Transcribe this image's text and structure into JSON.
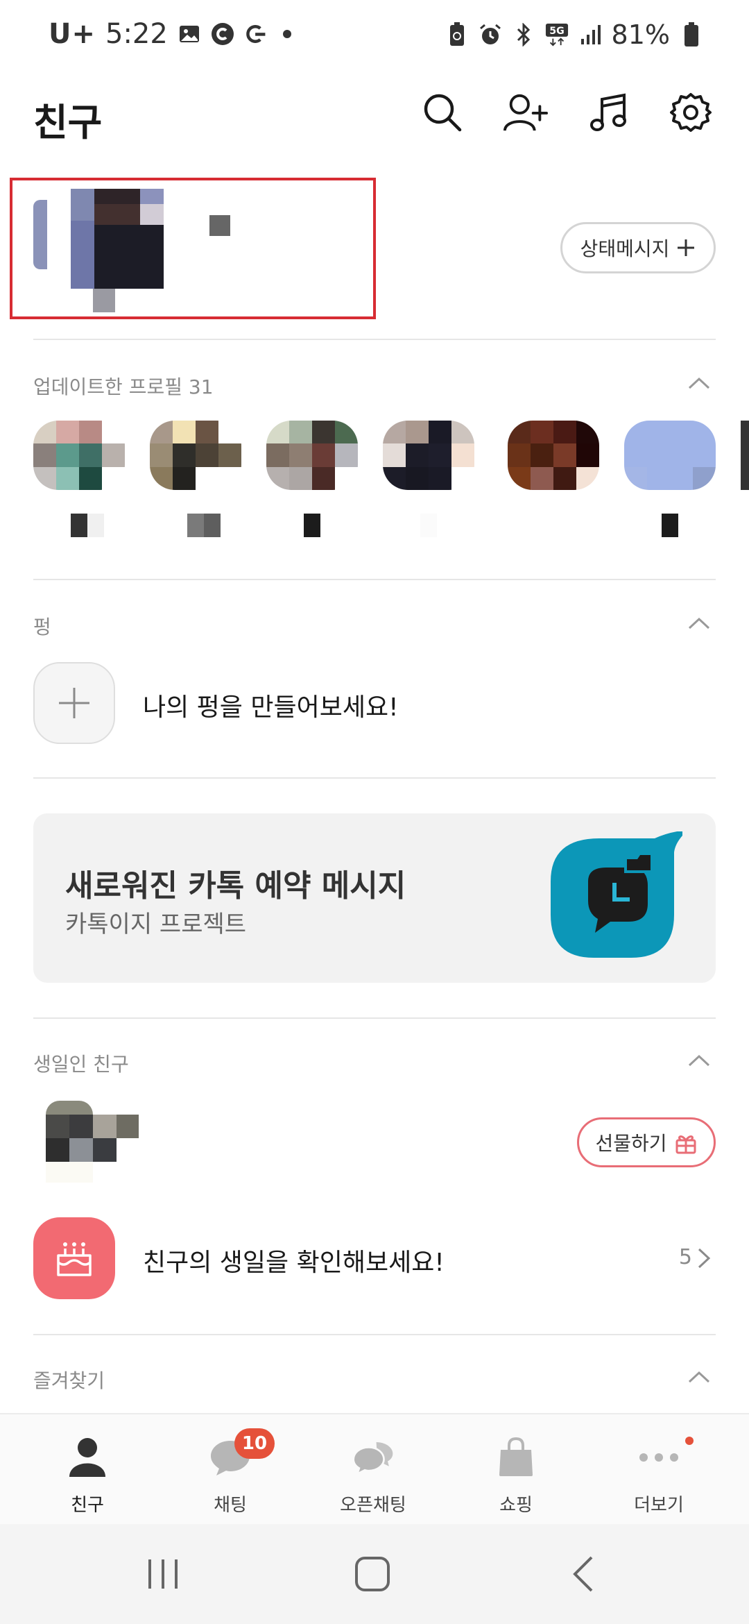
{
  "status_bar": {
    "carrier": "U+",
    "time": "5:22",
    "battery": "81%",
    "icons": [
      "gallery-icon",
      "c-icon",
      "g-icon",
      "recycle-battery-icon",
      "alarm-icon",
      "bluetooth-icon",
      "5g-icon",
      "signal-icon",
      "battery-icon"
    ]
  },
  "header": {
    "title": "친구",
    "icons": [
      "search-icon",
      "add-friend-icon",
      "music-icon",
      "settings-icon"
    ]
  },
  "my_profile": {
    "status_message_label": "상태메시지"
  },
  "updated_profiles": {
    "title": "업데이트한 프로필 31",
    "items": [
      {
        "colors": [
          "#d8cfc2",
          "#d6a9a4",
          "#b88a85",
          "#ffffff",
          "#8a807c",
          "#5c9a8c",
          "#3f6f66",
          "#b9b1ac",
          "#c4c0be",
          "#8cc0b4",
          "#1e4a40",
          "#ffffff"
        ]
      },
      {
        "colors": [
          "#a8988a",
          "#f2e2b4",
          "#6a5444",
          "#ffffff",
          "#9a8c74",
          "#2f2e2a",
          "#4c4236",
          "#6c604c",
          "#8a7a5c",
          "#23221f",
          "#ffffff",
          "#ffffff"
        ]
      },
      {
        "colors": [
          "#d6dac8",
          "#a6b4a2",
          "#3b3530",
          "#4c6a50",
          "#7b6c60",
          "#8e7e72",
          "#6a3c36",
          "#b6b6bc",
          "#b6b0ae",
          "#aca6a4",
          "#4a2a26",
          "#ffffff"
        ]
      },
      {
        "colors": [
          "#b6a8a2",
          "#aa988e",
          "#1a1a26",
          "#cdc4be",
          "#e4dcd8",
          "#1c1c28",
          "#1e1e2c",
          "#f4e0d2",
          "#1c1c28",
          "#181822",
          "#1a1a26",
          "#ffffff"
        ]
      },
      {
        "colors": [
          "#5a2a1a",
          "#6c2e20",
          "#4a1a14",
          "#200808",
          "#6a3218",
          "#4a2010",
          "#7a3a28",
          "#200606",
          "#7a3a18",
          "#8e5a50",
          "#401a12",
          "#f4e2d6"
        ]
      },
      {
        "colors": [
          "#a0b4e8",
          "#a0b4e8",
          "#a0b4e8",
          "#a0b4e8",
          "#a0b4e8",
          "#a0b4e8",
          "#a0b4e8",
          "#a0b4e8",
          "#a4b6e6",
          "#a0b4e8",
          "#a0b4e8",
          "#8fa0cc"
        ]
      }
    ]
  },
  "pyeong": {
    "title": "펑",
    "create_text": "나의 펑을 만들어보세요!"
  },
  "banner": {
    "title": "새로워진 카톡 예약 메시지",
    "subtitle": "카톡이지 프로젝트",
    "accent": "#0c97b8"
  },
  "birthday": {
    "title": "생일인 친구",
    "gift_label": "선물하기",
    "check_text": "친구의 생일을 확인해보세요!",
    "count": "5"
  },
  "favorites": {
    "title": "즐겨찾기"
  },
  "bottom_nav": {
    "items": [
      {
        "label": "친구",
        "icon": "person-icon",
        "active": true
      },
      {
        "label": "채팅",
        "icon": "chat-icon",
        "badge": "10"
      },
      {
        "label": "오픈채팅",
        "icon": "open-chat-icon"
      },
      {
        "label": "쇼핑",
        "icon": "shopping-bag-icon"
      },
      {
        "label": "더보기",
        "icon": "more-icon",
        "dot": true
      }
    ]
  },
  "system_nav": {
    "icons": [
      "recent-apps-icon",
      "home-icon",
      "back-icon"
    ]
  },
  "colors": {
    "highlight_border": "#d72c33",
    "badge": "#e5513a",
    "cake": "#f26a72"
  }
}
